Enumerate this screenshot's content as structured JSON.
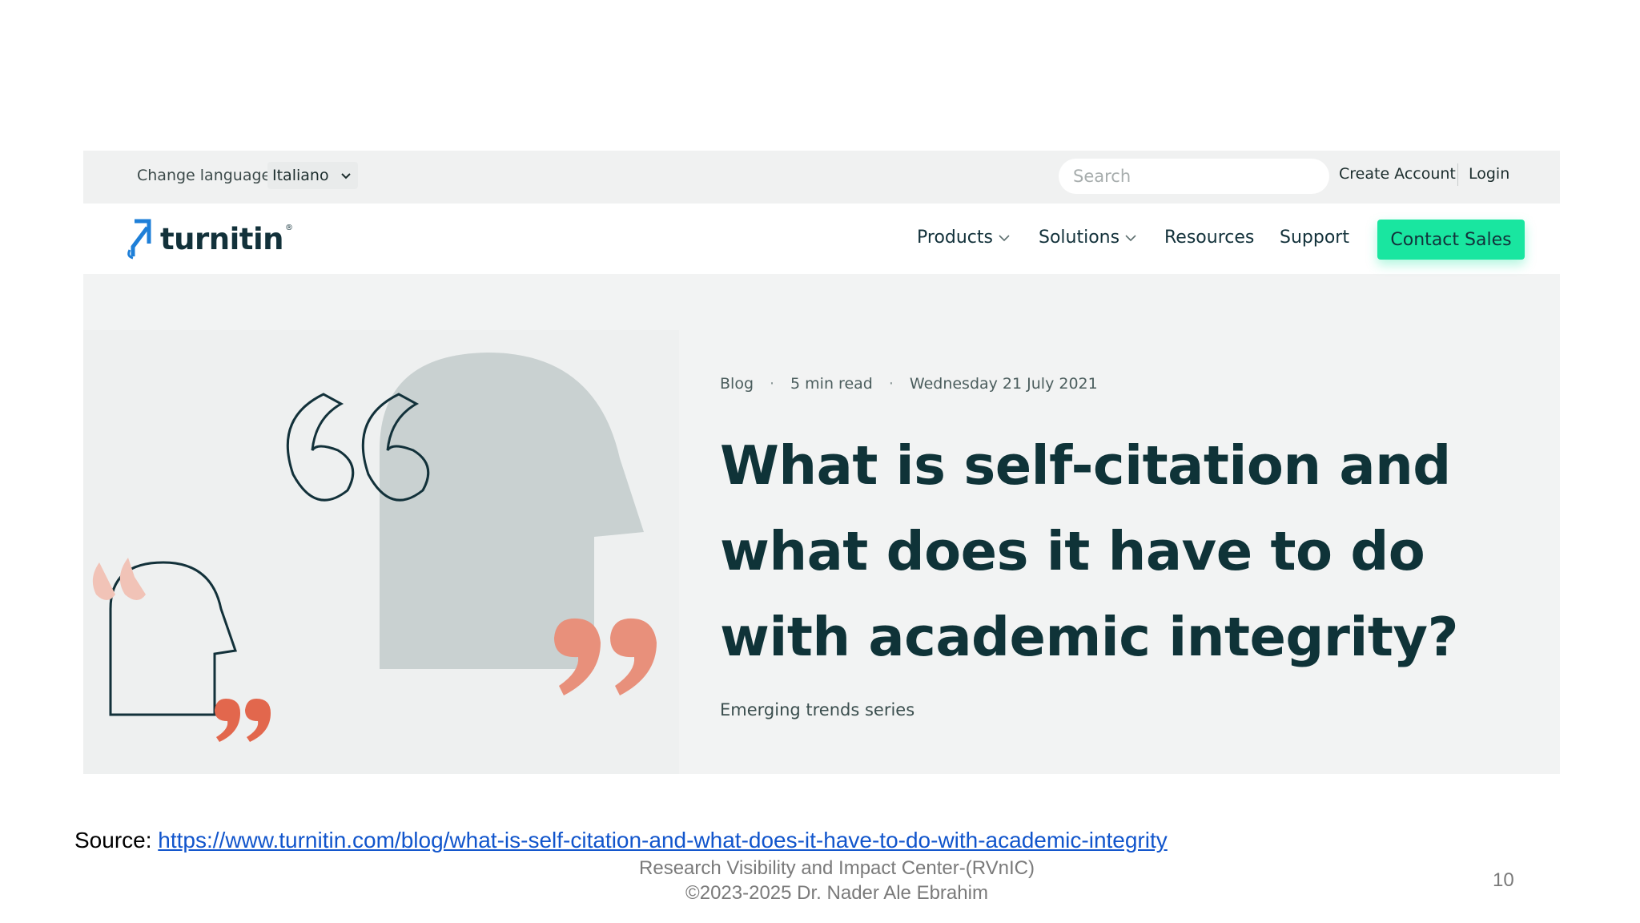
{
  "utility_bar": {
    "change_language_label": "Change language",
    "language_value": "Italiano",
    "search_placeholder": "Search",
    "create_account_label": "Create Account",
    "login_label": "Login"
  },
  "nav": {
    "logo_text": "turnitin",
    "items": [
      {
        "label": "Products",
        "has_dropdown": true
      },
      {
        "label": "Solutions",
        "has_dropdown": true
      },
      {
        "label": "Resources",
        "has_dropdown": false
      },
      {
        "label": "Support",
        "has_dropdown": false
      }
    ],
    "contact_sales_label": "Contact Sales"
  },
  "hero": {
    "meta": {
      "category": "Blog",
      "separator": "·",
      "read_time": "5 min read",
      "date": "Wednesday 21 July 2021"
    },
    "title": "What is self-citation and what does it have to do with academic integrity?",
    "series": "Emerging trends series"
  },
  "slide": {
    "source_prefix": "Source: ",
    "source_url": "https://www.turnitin.com/blog/what-is-self-citation-and-what-does-it-have-to-do-with-academic-integrity",
    "footer_line1": "Research Visibility and Impact Center-(RVnIC)",
    "footer_line2": "©2023-2025 Dr. Nader Ale Ebrahim",
    "page_number": "10"
  },
  "colors": {
    "brand_navy": "#12313a",
    "cta_green": "#19e6a0",
    "quote_coral": "#e8907b",
    "link_blue": "#1155cc"
  }
}
